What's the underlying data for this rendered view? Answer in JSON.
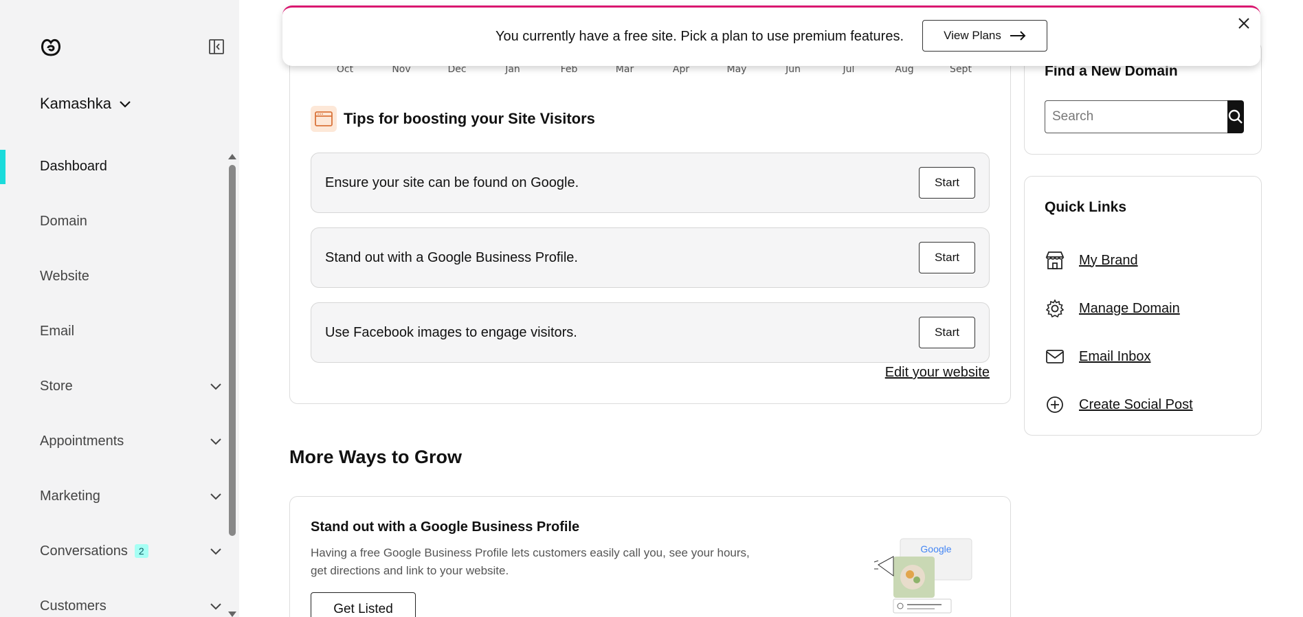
{
  "sidebar": {
    "account_name": "Kamashka",
    "items": [
      {
        "label": "Dashboard",
        "active": true,
        "has_caret": false
      },
      {
        "label": "Domain",
        "active": false,
        "has_caret": false
      },
      {
        "label": "Website",
        "active": false,
        "has_caret": false
      },
      {
        "label": "Email",
        "active": false,
        "has_caret": false
      },
      {
        "label": "Store",
        "active": false,
        "has_caret": true
      },
      {
        "label": "Appointments",
        "active": false,
        "has_caret": true
      },
      {
        "label": "Marketing",
        "active": false,
        "has_caret": true
      },
      {
        "label": "Conversations",
        "active": false,
        "has_caret": true,
        "badge": "2"
      },
      {
        "label": "Customers",
        "active": false,
        "has_caret": true
      }
    ]
  },
  "banner": {
    "text": "You currently have a free site. Pick a plan to use premium features.",
    "button_label": "View Plans",
    "accent_color": "#d9166f"
  },
  "chart_axis": {
    "months": [
      "Oct",
      "Nov",
      "Dec",
      "Jan",
      "Feb",
      "Mar",
      "Apr",
      "May",
      "Jun",
      "Jul",
      "Aug",
      "Sept"
    ]
  },
  "tips": {
    "title": "Tips for boosting your Site Visitors",
    "items": [
      {
        "text": "Ensure your site can be found on Google.",
        "button": "Start"
      },
      {
        "text": "Stand out with a Google Business Profile.",
        "button": "Start"
      },
      {
        "text": "Use Facebook images to engage visitors.",
        "button": "Start"
      }
    ],
    "edit_link": "Edit your website"
  },
  "grow": {
    "heading": "More Ways to Grow",
    "card_title": "Stand out with a Google Business Profile",
    "card_description": "Having a free Google Business Profile lets customers easily call you, see your hours, get directions and link to your website.",
    "card_button": "Get Listed",
    "illustration_label": "Google"
  },
  "domain_search": {
    "title": "Find a New Domain",
    "placeholder": "Search"
  },
  "quick_links": {
    "title": "Quick Links",
    "items": [
      {
        "label": "My Brand",
        "icon": "store-icon"
      },
      {
        "label": "Manage Domain",
        "icon": "gear-icon"
      },
      {
        "label": "Email Inbox",
        "icon": "mail-icon"
      },
      {
        "label": "Create Social Post",
        "icon": "plus-circle-icon"
      }
    ]
  },
  "colors": {
    "active_indicator": "#1bdbdb",
    "badge_bg": "#a6fff4",
    "sidebar_bg": "#f3f3f4"
  }
}
